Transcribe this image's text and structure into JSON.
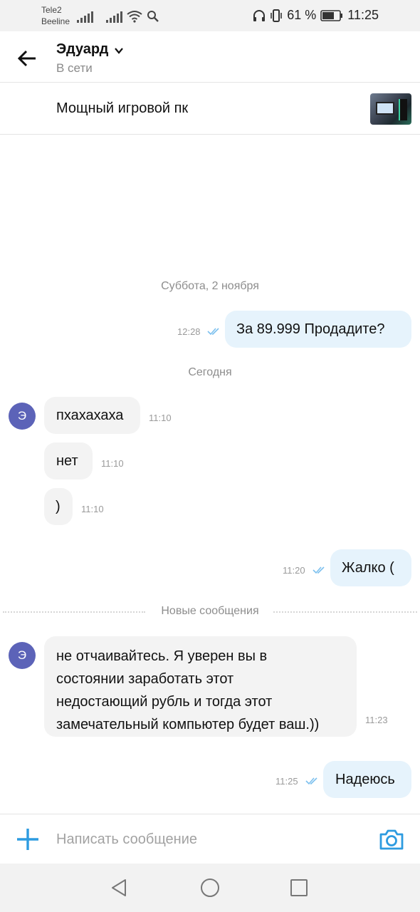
{
  "status_bar": {
    "carrier1": "Tele2",
    "carrier2": "Beeline",
    "battery": "61 %",
    "time": "11:25"
  },
  "header": {
    "name": "Эдуард",
    "status": "В сети"
  },
  "listing": {
    "title": "Мощный игровой пк"
  },
  "chat": {
    "date1": "Суббота, 2 ноября",
    "date2": "Сегодня",
    "new_messages": "Новые сообщения",
    "avatar_letter": "Э",
    "messages": [
      {
        "dir": "out",
        "text": "За 89.999 Продадите?",
        "time": "12:28"
      },
      {
        "dir": "in",
        "text": "пхахахаха",
        "time": "11:10"
      },
      {
        "dir": "in",
        "text": "нет",
        "time": "11:10"
      },
      {
        "dir": "in",
        "text": ")",
        "time": "11:10"
      },
      {
        "dir": "out",
        "text": "Жалко (",
        "time": "11:20"
      },
      {
        "dir": "in",
        "lines": [
          "не отчаивайтесь. Я уверен вы в",
          "состоянии заработать этот",
          "недостающий рубль и тогда этот",
          "замечательный компьютер будет ваш.))"
        ],
        "time": "11:23"
      },
      {
        "dir": "out",
        "text": "Надеюсь",
        "time": "11:25"
      }
    ]
  },
  "composer": {
    "placeholder": "Написать сообщение"
  },
  "colors": {
    "accent": "#2d9be0",
    "out_bubble": "#e6f3fc",
    "in_bubble": "#f3f3f3",
    "avatar": "#5c63b8"
  },
  "icons": [
    "back-arrow-icon",
    "chevron-down-icon",
    "plus-icon",
    "camera-icon",
    "double-check-icon",
    "nav-back-icon",
    "nav-home-icon",
    "nav-recents-icon"
  ]
}
